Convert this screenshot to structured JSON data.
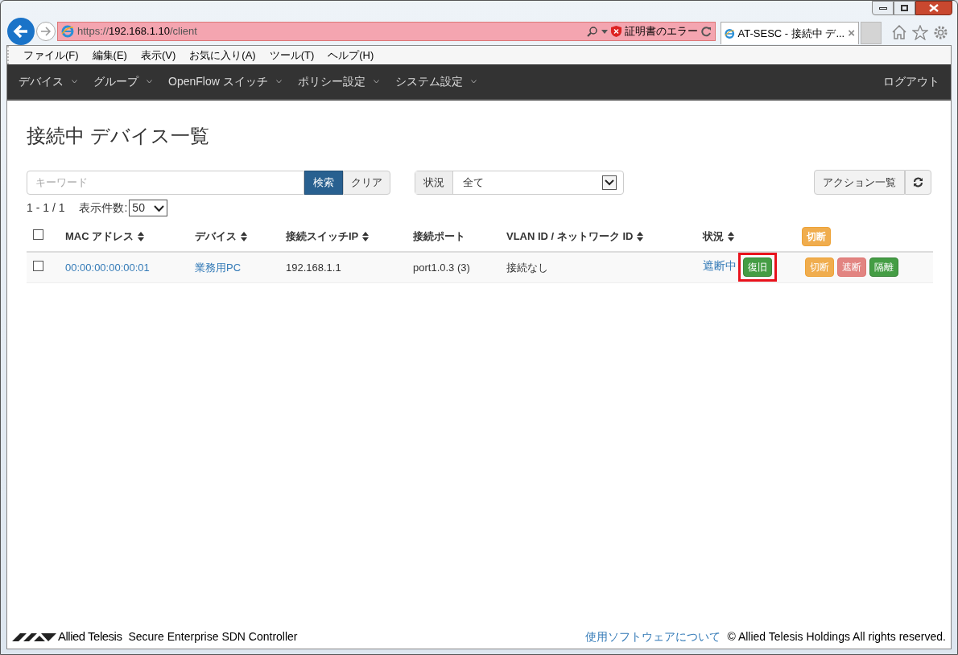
{
  "browser": {
    "url_scheme": "https://",
    "url_host": "192.168.1.10",
    "url_path": "/client",
    "cert_error": "証明書のエラー",
    "tab_title": "AT-SESC - 接続中 デ...",
    "tab_close": "×"
  },
  "menu_bar": [
    "ファイル(F)",
    "編集(E)",
    "表示(V)",
    "お気に入り(A)",
    "ツール(T)",
    "ヘルプ(H)"
  ],
  "navbar": {
    "items": [
      "デバイス",
      "グループ",
      "OpenFlow スイッチ",
      "ポリシー設定",
      "システム設定"
    ],
    "logout": "ログアウト"
  },
  "page_title": "接続中 デバイス一覧",
  "search": {
    "placeholder": "キーワード",
    "search_button": "検索",
    "clear_button": "クリア"
  },
  "status_filter": {
    "label": "状況",
    "value": "全て"
  },
  "action_list_button": "アクション一覧",
  "pagination": {
    "range": "1 - 1 / 1",
    "per_page_label": "表示件数:",
    "per_page": "50"
  },
  "table": {
    "columns": [
      {
        "label": "MAC アドレス",
        "sortable": true
      },
      {
        "label": "デバイス",
        "sortable": true
      },
      {
        "label": "接続スイッチIP",
        "sortable": true
      },
      {
        "label": "接続ポート",
        "sortable": false
      },
      {
        "label": "VLAN ID / ネットワーク ID",
        "sortable": true
      },
      {
        "label": "状況",
        "sortable": true
      }
    ],
    "select_all_checked": false,
    "header_action": {
      "label": "切断",
      "kind": "disconnect"
    },
    "rows": [
      {
        "checked": false,
        "mac": "00:00:00:00:00:01",
        "device": "業務用PC",
        "switch_ip": "192.168.1.1",
        "port": "port1.0.3 (3)",
        "vlan": "接続なし",
        "status": "遮断中",
        "status_action": {
          "label": "復旧",
          "kind": "restore",
          "highlighted": true
        },
        "actions": [
          {
            "label": "切断",
            "kind": "disconnect",
            "disabled": false
          },
          {
            "label": "遮断",
            "kind": "block",
            "disabled": true
          },
          {
            "label": "隔離",
            "kind": "quarantine",
            "disabled": false
          }
        ]
      }
    ]
  },
  "footer": {
    "brand": "Allied Telesis",
    "product": "Secure Enterprise SDN Controller",
    "link": "使用ソフトウェアについて",
    "copyright": "© Allied Telesis Holdings All rights reserved."
  }
}
